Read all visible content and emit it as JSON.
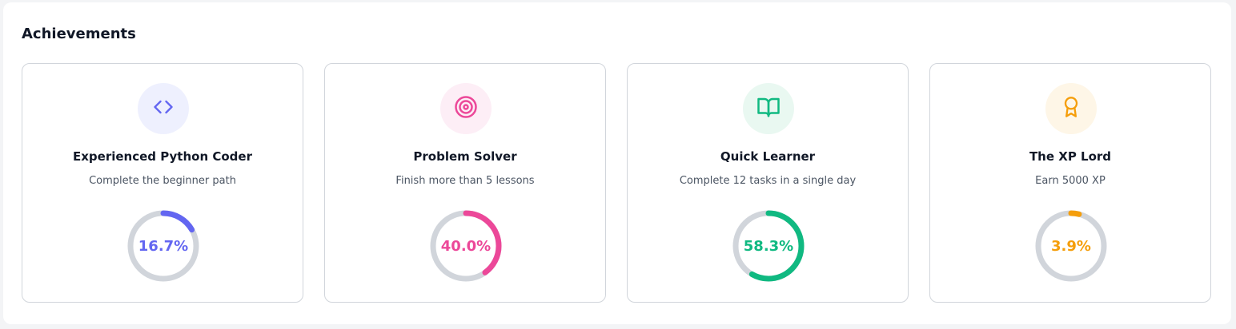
{
  "title": "Achievements",
  "achievements": [
    {
      "icon": "code-icon",
      "title": "Experienced Python Coder",
      "description": "Complete the beginner path",
      "progress": 16.7,
      "progress_label": "16.7%",
      "color": "#6366f1",
      "bg_color": "#eef0fe"
    },
    {
      "icon": "target-icon",
      "title": "Problem Solver",
      "description": "Finish more than 5 lessons",
      "progress": 40.0,
      "progress_label": "40.0%",
      "color": "#ec4899",
      "bg_color": "#fdeef6"
    },
    {
      "icon": "book-open-icon",
      "title": "Quick Learner",
      "description": "Complete 12 tasks in a single day",
      "progress": 58.3,
      "progress_label": "58.3%",
      "color": "#10b981",
      "bg_color": "#e9f8f1"
    },
    {
      "icon": "award-icon",
      "title": "The XP Lord",
      "description": "Earn 5000 XP",
      "progress": 3.9,
      "progress_label": "3.9%",
      "color": "#f59e0b",
      "bg_color": "#fef6e7"
    }
  ],
  "track_color": "#d1d5db"
}
